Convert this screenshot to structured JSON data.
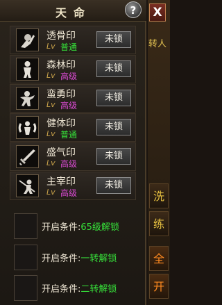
{
  "panel": {
    "title": "天命",
    "help_label": "?"
  },
  "seals": [
    {
      "name": "透骨印",
      "lv": "Lv",
      "grade": "普通",
      "grade_type": "normal",
      "button": "未锁",
      "icon": "dagger-figure-icon"
    },
    {
      "name": "森林印",
      "lv": "Lv",
      "grade": "高级",
      "grade_type": "high",
      "button": "未锁",
      "icon": "warrior-silhouette-icon"
    },
    {
      "name": "蛮勇印",
      "lv": "Lv",
      "grade": "高级",
      "grade_type": "high",
      "button": "未锁",
      "icon": "berserker-icon"
    },
    {
      "name": "健体印",
      "lv": "Lv",
      "grade": "普通",
      "grade_type": "normal",
      "button": "未锁",
      "icon": "body-aura-icon"
    },
    {
      "name": "盛气印",
      "lv": "Lv",
      "grade": "高级",
      "grade_type": "high",
      "button": "未锁",
      "icon": "sword-icon"
    },
    {
      "name": "主宰印",
      "lv": "Lv",
      "grade": "高级",
      "grade_type": "high",
      "button": "未锁",
      "icon": "ruler-figure-icon"
    }
  ],
  "locked_slots": [
    {
      "label": "开启条件:",
      "value": "65级解锁"
    },
    {
      "label": "开启条件:",
      "value": "一转解锁"
    },
    {
      "label": "开启条件:",
      "value": "二转解锁"
    }
  ],
  "side": {
    "close_label": "X",
    "partial_top": "转人",
    "btn_wash": "洗",
    "btn_train": "练",
    "btn_all": "全",
    "btn_open": "开"
  },
  "colors": {
    "normal": "#36e23a",
    "high": "#d74ad0",
    "condition_value": "#36e23a"
  }
}
